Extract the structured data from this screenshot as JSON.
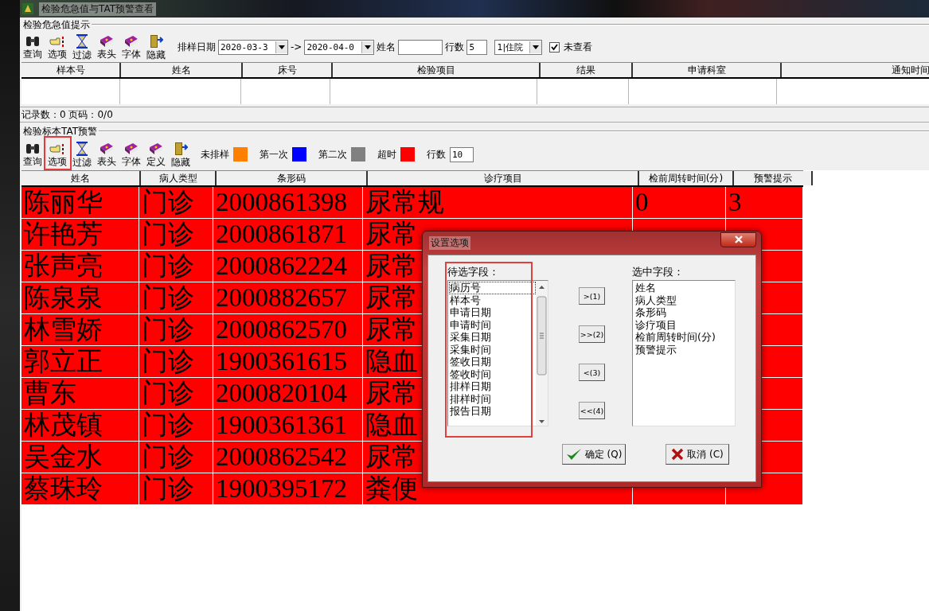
{
  "window": {
    "title": "检验危急值与TAT预警查看"
  },
  "critical": {
    "group_title": "检验危急值提示",
    "toolbar": [
      {
        "label": "查询",
        "kind": "binoculars"
      },
      {
        "label": "选项",
        "kind": "hand"
      },
      {
        "label": "过滤",
        "kind": "hourglass"
      },
      {
        "label": "表头",
        "kind": "book"
      },
      {
        "label": "字体",
        "kind": "book"
      },
      {
        "label": "隐藏",
        "kind": "door"
      }
    ],
    "filters": {
      "date_label": "排样日期",
      "date_from": "2020-03-3",
      "arrow": "->",
      "date_to": "2020-04-0",
      "name_label": "姓名",
      "rows_label": "行数",
      "rows_value": "5",
      "patient_type": "1|住院",
      "unviewed": {
        "label": "未查看",
        "checked": true
      }
    },
    "columns": [
      "样本号",
      "姓名",
      "床号",
      "检验项目",
      "结果",
      "申请科室",
      "通知时间"
    ],
    "status": "记录数：0 页码：0/0"
  },
  "tat": {
    "group_title": "检验标本TAT预警",
    "toolbar": [
      {
        "label": "查询",
        "kind": "binoculars"
      },
      {
        "label": "选项",
        "kind": "hand"
      },
      {
        "label": "过滤",
        "kind": "hourglass"
      },
      {
        "label": "表头",
        "kind": "book"
      },
      {
        "label": "字体",
        "kind": "book"
      },
      {
        "label": "定义",
        "kind": "book"
      },
      {
        "label": "隐藏",
        "kind": "door"
      }
    ],
    "legend": [
      {
        "label": "未排样",
        "color": "#ff8000"
      },
      {
        "label": "第一次",
        "color": "#0000ff"
      },
      {
        "label": "第二次",
        "color": "#808080"
      },
      {
        "label": "超时",
        "color": "#ff0000"
      }
    ],
    "rows_label": "行数",
    "rows_value": "10",
    "columns": [
      "姓名",
      "病人类型",
      "条形码",
      "诊疗项目",
      "检前周转时间(分)",
      "预警提示"
    ],
    "rows": [
      {
        "color": "#ff0000",
        "cells": [
          "陈丽华",
          "门诊",
          "2000861398",
          "尿常规",
          "0",
          "3"
        ]
      },
      {
        "color": "#ff0000",
        "cells": [
          "许艳芳",
          "门诊",
          "2000861871",
          "尿常"
        ]
      },
      {
        "color": "#ff0000",
        "cells": [
          "张声亮",
          "门诊",
          "2000862224",
          "尿常"
        ]
      },
      {
        "color": "#ff0000",
        "cells": [
          "陈泉泉",
          "门诊",
          "2000882657",
          "尿常"
        ]
      },
      {
        "color": "#ff0000",
        "cells": [
          "林雪娇",
          "门诊",
          "2000862570",
          "尿常"
        ]
      },
      {
        "color": "#ff0000",
        "cells": [
          "郭立正",
          "门诊",
          "1900361615",
          "隐血"
        ]
      },
      {
        "color": "#ff0000",
        "cells": [
          "曹东",
          "门诊",
          "2000820104",
          "尿常"
        ]
      },
      {
        "color": "#ff0000",
        "cells": [
          "林茂镇",
          "门诊",
          "1900361361",
          "隐血"
        ]
      },
      {
        "color": "#ff0000",
        "cells": [
          "吴金水",
          "门诊",
          "2000862542",
          "尿常"
        ]
      },
      {
        "color": "#ff0000",
        "cells": [
          "蔡珠玲",
          "门诊",
          "1900395172",
          "粪便"
        ]
      }
    ]
  },
  "dialog": {
    "title": "设置选项",
    "available_label": "待选字段：",
    "available": [
      {
        "label": "病历号",
        "focused": true
      },
      {
        "label": "样本号",
        "focused": false
      },
      {
        "label": "申请日期",
        "focused": false
      },
      {
        "label": "申请时间",
        "focused": false
      },
      {
        "label": "采集日期",
        "focused": false
      },
      {
        "label": "采集时间",
        "focused": false
      },
      {
        "label": "签收日期",
        "focused": false
      },
      {
        "label": "签收时间",
        "focused": false
      },
      {
        "label": "排样日期",
        "focused": false
      },
      {
        "label": "排样时间",
        "focused": false
      },
      {
        "label": "报告日期",
        "focused": false
      }
    ],
    "move_buttons": [
      ">(1)",
      ">>(2)",
      "<(3)",
      "<<(4)"
    ],
    "selected_label": "选中字段：",
    "selected": [
      "姓名",
      "病人类型",
      "条形码",
      "诊疗项目",
      "检前周转时间(分)",
      "预警提示"
    ],
    "ok": "确定 (Q)",
    "cancel": "取消 (C)"
  }
}
